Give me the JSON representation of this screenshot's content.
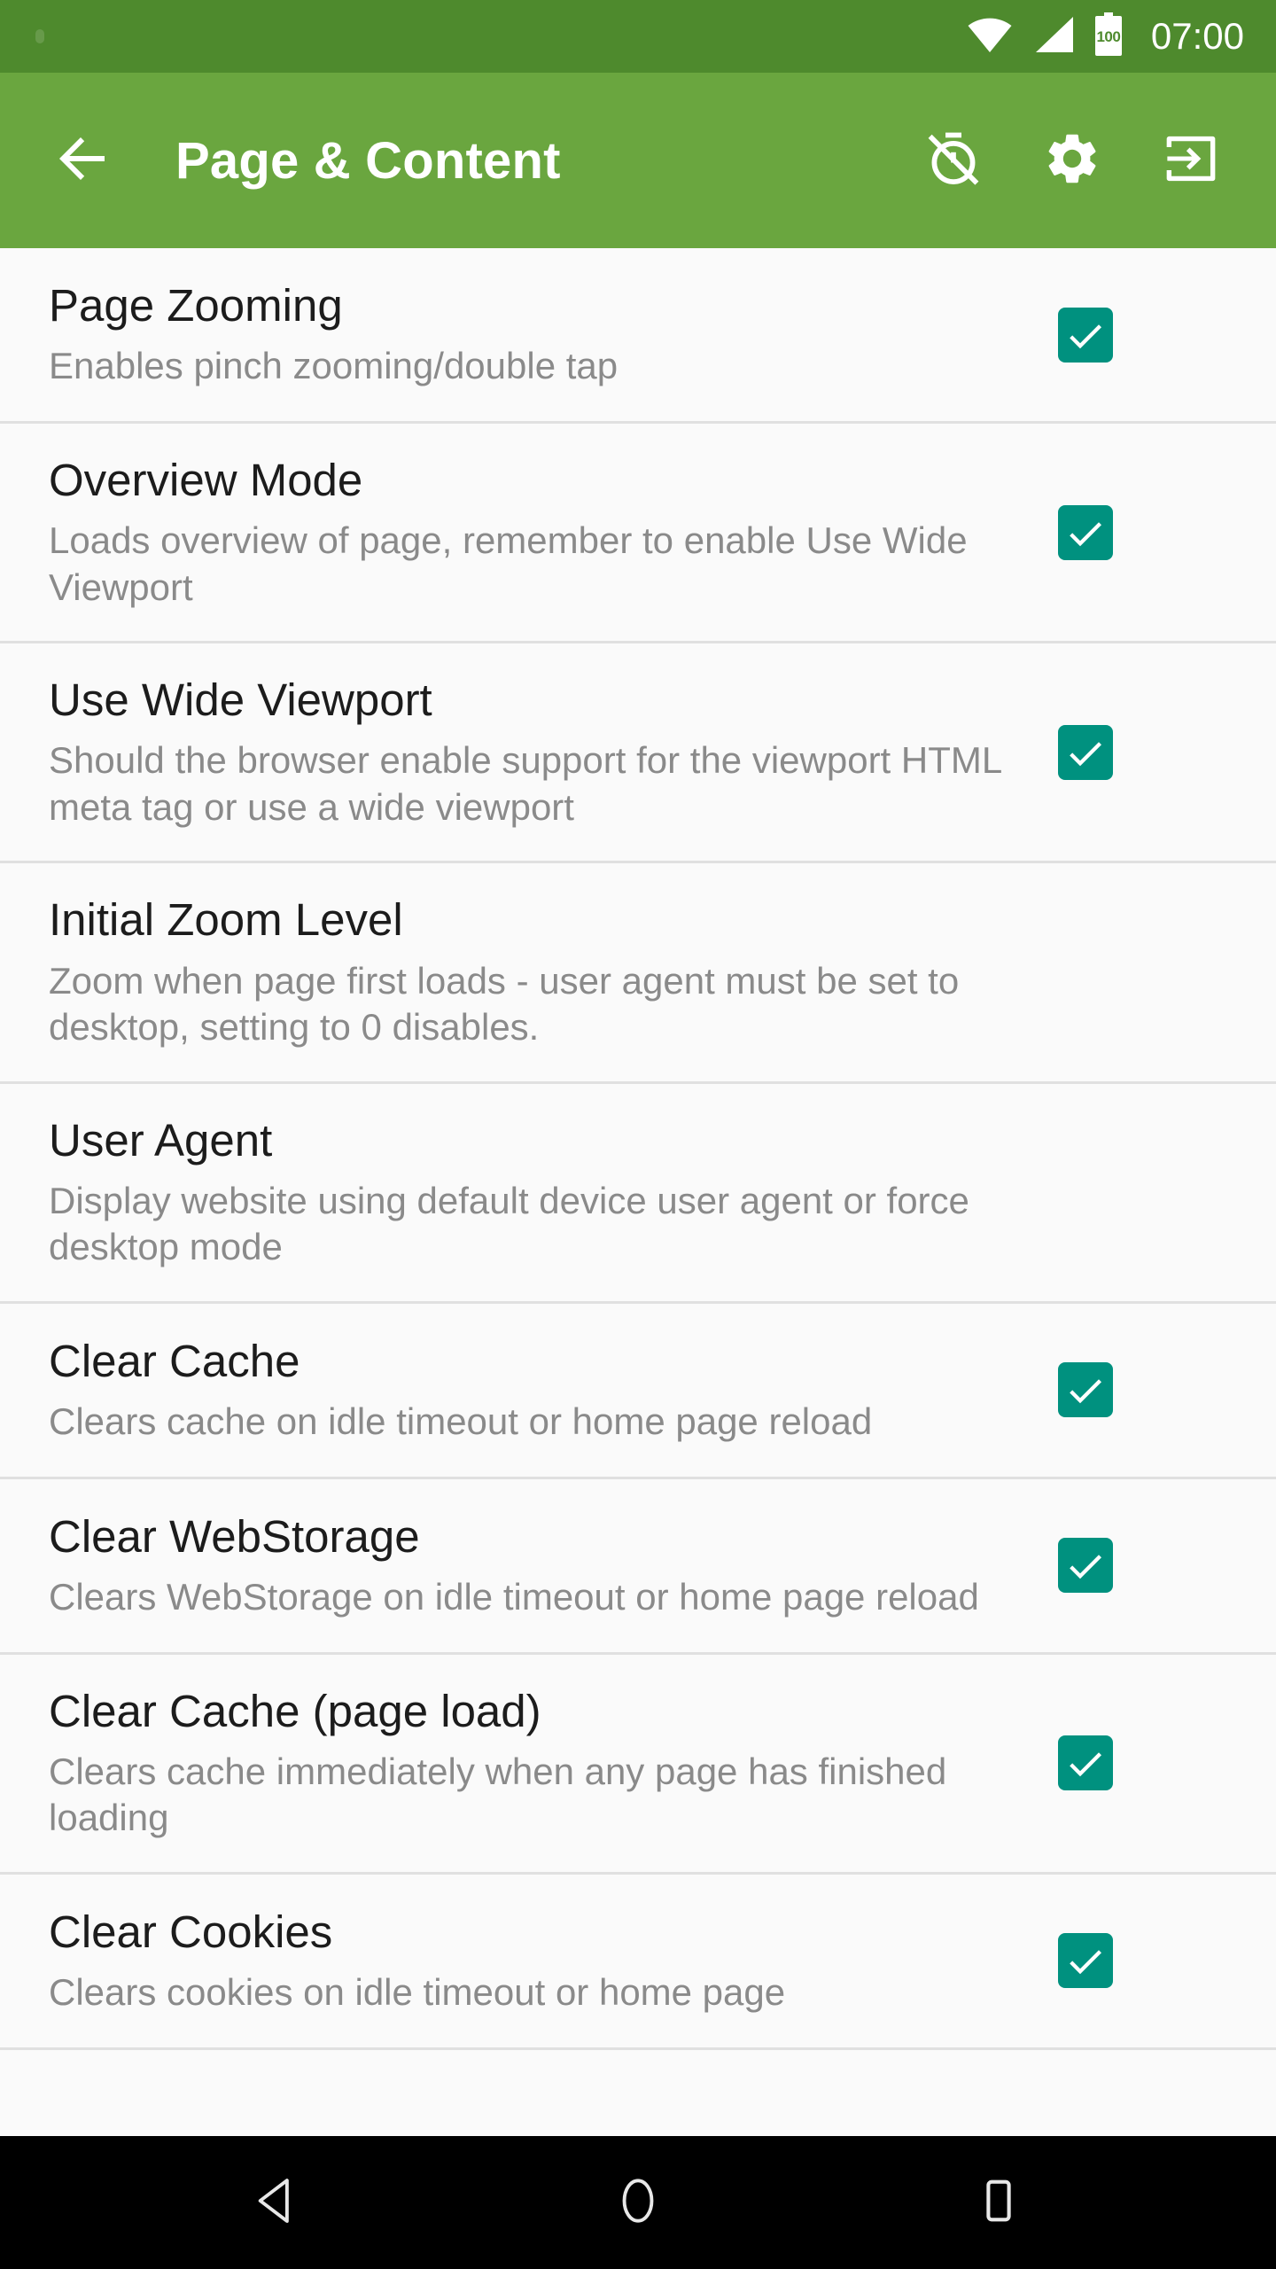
{
  "status_bar": {
    "wifi_icon": "wifi-icon",
    "signal_icon": "cellular-signal-icon",
    "battery_icon": "battery-icon",
    "battery_level": "100",
    "clock": "07:00",
    "background_color": "#4e8a2d"
  },
  "app_bar": {
    "back_icon": "back-arrow-icon",
    "title": "Page & Content",
    "background_color": "#6aa63f",
    "actions": [
      {
        "icon": "timer-off-icon",
        "label": "Timer Off"
      },
      {
        "icon": "gear-icon",
        "label": "Settings"
      },
      {
        "icon": "exit-to-app-icon",
        "label": "Exit"
      }
    ]
  },
  "settings": {
    "accent_color": "#00917f",
    "items": [
      {
        "title": "Page Zooming",
        "summary": "Enables pinch zooming/double tap",
        "has_checkbox": true,
        "checked": true
      },
      {
        "title": "Overview Mode",
        "summary": "Loads overview of page, remember to enable Use Wide Viewport",
        "has_checkbox": true,
        "checked": true
      },
      {
        "title": "Use Wide Viewport",
        "summary": "Should the browser enable support for the viewport HTML meta tag or use a wide viewport",
        "has_checkbox": true,
        "checked": true
      },
      {
        "title": "Initial Zoom Level",
        "summary": "Zoom when page first loads - user agent must be set to desktop, setting to 0 disables.",
        "has_checkbox": false,
        "checked": false
      },
      {
        "title": "User Agent",
        "summary": "Display website using default device user agent or force desktop mode",
        "has_checkbox": false,
        "checked": false
      },
      {
        "title": "Clear Cache",
        "summary": "Clears cache on idle timeout or home page reload",
        "has_checkbox": true,
        "checked": true
      },
      {
        "title": "Clear WebStorage",
        "summary": "Clears WebStorage on idle timeout or home page reload",
        "has_checkbox": true,
        "checked": true
      },
      {
        "title": "Clear Cache (page load)",
        "summary": "Clears cache immediately when any page has finished loading",
        "has_checkbox": true,
        "checked": true
      },
      {
        "title": "Clear Cookies",
        "summary": "Clears cookies on idle timeout or home page",
        "has_checkbox": true,
        "checked": true
      }
    ]
  },
  "nav_bar": {
    "background_color": "#000000",
    "buttons": [
      {
        "icon": "nav-back-icon",
        "label": "Back"
      },
      {
        "icon": "nav-home-icon",
        "label": "Home"
      },
      {
        "icon": "nav-recents-icon",
        "label": "Recents"
      }
    ]
  }
}
